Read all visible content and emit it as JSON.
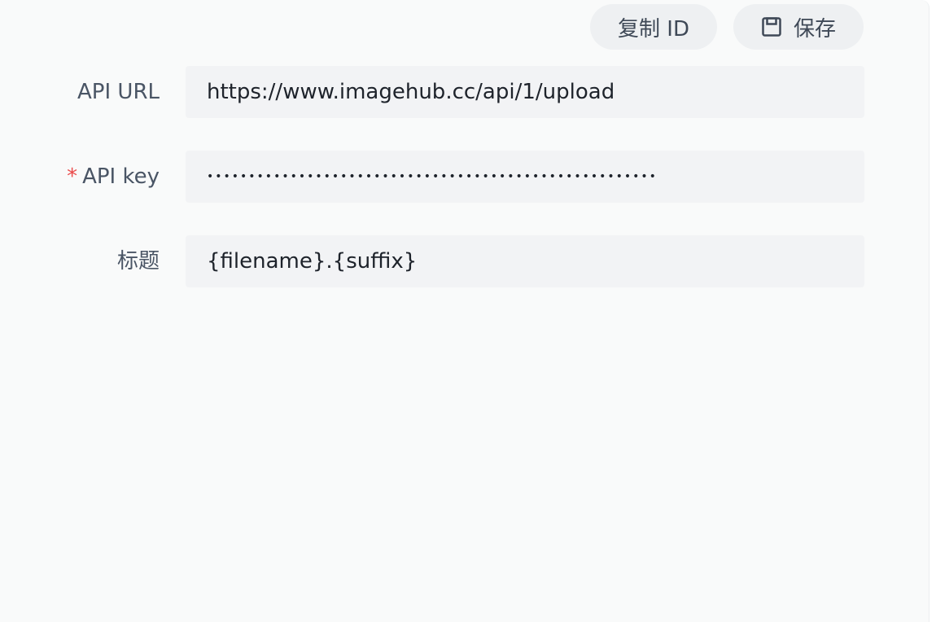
{
  "toolbar": {
    "copy_id_label": "复制 ID",
    "save_label": "保存"
  },
  "form": {
    "api_url": {
      "label": "API URL",
      "value": "https://www.imagehub.cc/api/1/upload"
    },
    "api_key": {
      "label": "API key",
      "required_mark": "*",
      "value": "••••••••••••••••••••••••••••••••••••••••••••••••••••••"
    },
    "title": {
      "label": "标题",
      "value": "{filename}.{suffix}"
    }
  },
  "icons": {
    "save": "floppy-disk-icon"
  },
  "colors": {
    "required": "#ea4a4a",
    "input_background": "#f2f3f5",
    "button_background": "#eef0f2",
    "label_text": "#4a5565"
  }
}
